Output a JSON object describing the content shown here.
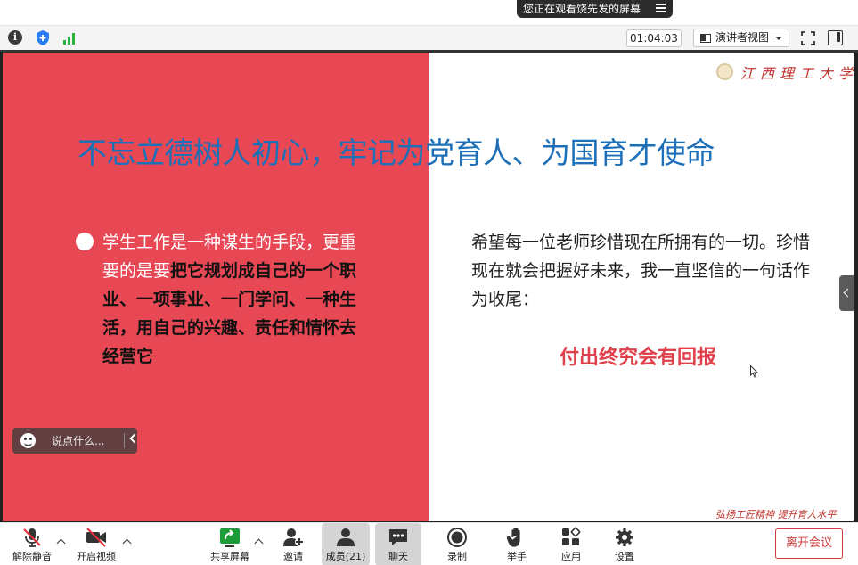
{
  "share_banner": {
    "text": "您正在观看饶先发的屏幕",
    "menu_icon": "menu-icon"
  },
  "meeting_bar": {
    "info_icon": "i",
    "timer": "01:04:03",
    "view_select": "演讲者视图"
  },
  "slide": {
    "university": "江西理工大学",
    "title": "不忘立德树人初心，牢记为党育人、为国育才使命",
    "left_text_plain": "学生工作是一种谋生的手段，更重要的是要",
    "left_text_bold": "把它规划成自己的一个职业、一项事业、一门学问、一种生活，用自己的兴趣、责任和情怀去经营它",
    "right_text": "希望每一位老师珍惜现在所拥有的一切。珍惜现在就会把握好未来，我一直坚信的一句话作为收尾：",
    "highlight": "付出终究会有回报",
    "motto": "弘扬工匠精神  提升育人水平",
    "colors": {
      "red_panel": "#e84854",
      "title_blue": "#1d6fb8",
      "highlight_red": "#e0404c"
    }
  },
  "comment_box": {
    "placeholder": "说点什么..."
  },
  "controls": {
    "unmute": "解除静音",
    "start_video": "开启视频",
    "share_screen": "共享屏幕",
    "invite": "邀请",
    "participants": "成员(21)",
    "chat": "聊天",
    "record": "录制",
    "raise_hand": "举手",
    "apps": "应用",
    "settings": "设置",
    "leave": "离开会议"
  }
}
